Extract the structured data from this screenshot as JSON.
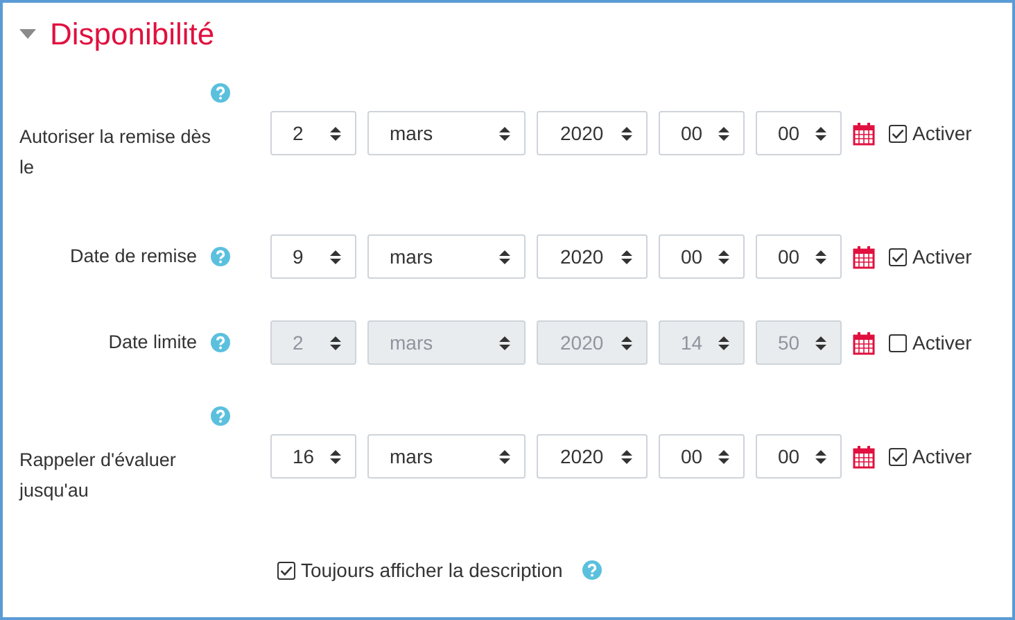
{
  "section": {
    "title": "Disponibilité",
    "expanded": true
  },
  "fields": [
    {
      "label": "Autoriser la remise dès le",
      "help": true,
      "disabled": false,
      "selects": [
        "2",
        "mars",
        "2020",
        "00",
        "00"
      ],
      "enable": {
        "label": "Activer",
        "checked": true
      }
    },
    {
      "label": "Date de remise",
      "help": true,
      "disabled": false,
      "selects": [
        "9",
        "mars",
        "2020",
        "00",
        "00"
      ],
      "enable": {
        "label": "Activer",
        "checked": true
      }
    },
    {
      "label": "Date limite",
      "help": true,
      "disabled": true,
      "selects": [
        "2",
        "mars",
        "2020",
        "14",
        "50"
      ],
      "enable": {
        "label": "Activer",
        "checked": false
      }
    },
    {
      "label": "Rappeler d'évaluer jusqu'au",
      "help": true,
      "disabled": false,
      "selects": [
        "16",
        "mars",
        "2020",
        "00",
        "00"
      ],
      "enable": {
        "label": "Activer",
        "checked": true
      }
    }
  ],
  "always_show_description": {
    "label": "Toujours afficher la description",
    "checked": true,
    "help": true
  }
}
